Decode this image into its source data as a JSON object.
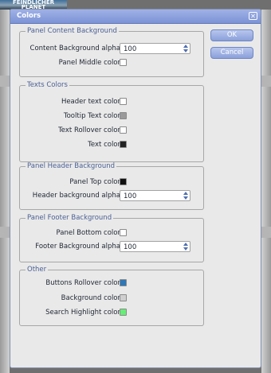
{
  "background": {
    "thumb_line1": "FEINDLICHER",
    "thumb_line2": "PLANET"
  },
  "dialog": {
    "title": "Colors",
    "close_symbol": "✕",
    "ok_label": "OK",
    "cancel_label": "Cancel"
  },
  "sections": {
    "content": {
      "title": "Panel Content Background",
      "alpha_label": "Content Background alpha",
      "alpha_value": "100",
      "middle_label": "Panel Middle color",
      "middle_color": "#ffffff"
    },
    "texts": {
      "title": "Texts Colors",
      "header_label": "Header text color",
      "header_color": "#ffffff",
      "tooltip_label": "Tooltip Text color",
      "tooltip_color": "#9a9a9a",
      "rollover_label": "Text Rollover color",
      "rollover_color": "#ffffff",
      "text_label": "Text color",
      "text_color": "#222222"
    },
    "header": {
      "title": "Panel Header Background",
      "top_label": "Panel Top color",
      "top_color": "#111111",
      "alpha_label": "Header background alpha",
      "alpha_value": "100"
    },
    "footer": {
      "title": "Panel Footer Background",
      "bottom_label": "Panel Bottom color",
      "bottom_color": "#ffffff",
      "alpha_label": "Footer Background alpha",
      "alpha_value": "100"
    },
    "other": {
      "title": "Other",
      "buttons_label": "Buttons Rollover color",
      "buttons_color": "#2f78b8",
      "background_label": "Background color",
      "background_color": "#cfcfcf",
      "highlight_label": "Search Highlight color",
      "highlight_color": "#66ee77"
    }
  }
}
